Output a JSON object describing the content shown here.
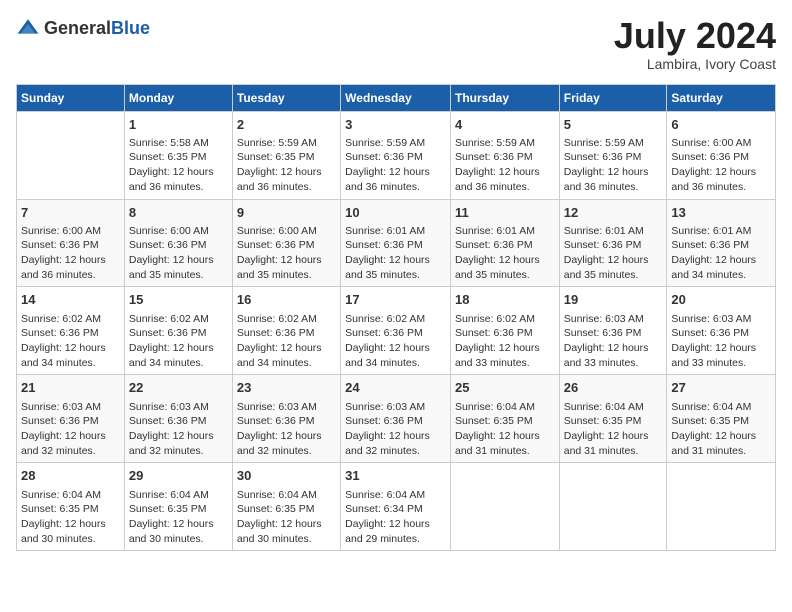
{
  "header": {
    "logo_general": "General",
    "logo_blue": "Blue",
    "main_title": "July 2024",
    "subtitle": "Lambira, Ivory Coast"
  },
  "days": [
    "Sunday",
    "Monday",
    "Tuesday",
    "Wednesday",
    "Thursday",
    "Friday",
    "Saturday"
  ],
  "weeks": [
    [
      {
        "date": "",
        "info": ""
      },
      {
        "date": "1",
        "info": "Sunrise: 5:58 AM\nSunset: 6:35 PM\nDaylight: 12 hours and 36 minutes."
      },
      {
        "date": "2",
        "info": "Sunrise: 5:59 AM\nSunset: 6:35 PM\nDaylight: 12 hours and 36 minutes."
      },
      {
        "date": "3",
        "info": "Sunrise: 5:59 AM\nSunset: 6:36 PM\nDaylight: 12 hours and 36 minutes."
      },
      {
        "date": "4",
        "info": "Sunrise: 5:59 AM\nSunset: 6:36 PM\nDaylight: 12 hours and 36 minutes."
      },
      {
        "date": "5",
        "info": "Sunrise: 5:59 AM\nSunset: 6:36 PM\nDaylight: 12 hours and 36 minutes."
      },
      {
        "date": "6",
        "info": "Sunrise: 6:00 AM\nSunset: 6:36 PM\nDaylight: 12 hours and 36 minutes."
      }
    ],
    [
      {
        "date": "7",
        "info": "Sunrise: 6:00 AM\nSunset: 6:36 PM\nDaylight: 12 hours and 36 minutes."
      },
      {
        "date": "8",
        "info": "Sunrise: 6:00 AM\nSunset: 6:36 PM\nDaylight: 12 hours and 35 minutes."
      },
      {
        "date": "9",
        "info": "Sunrise: 6:00 AM\nSunset: 6:36 PM\nDaylight: 12 hours and 35 minutes."
      },
      {
        "date": "10",
        "info": "Sunrise: 6:01 AM\nSunset: 6:36 PM\nDaylight: 12 hours and 35 minutes."
      },
      {
        "date": "11",
        "info": "Sunrise: 6:01 AM\nSunset: 6:36 PM\nDaylight: 12 hours and 35 minutes."
      },
      {
        "date": "12",
        "info": "Sunrise: 6:01 AM\nSunset: 6:36 PM\nDaylight: 12 hours and 35 minutes."
      },
      {
        "date": "13",
        "info": "Sunrise: 6:01 AM\nSunset: 6:36 PM\nDaylight: 12 hours and 34 minutes."
      }
    ],
    [
      {
        "date": "14",
        "info": "Sunrise: 6:02 AM\nSunset: 6:36 PM\nDaylight: 12 hours and 34 minutes."
      },
      {
        "date": "15",
        "info": "Sunrise: 6:02 AM\nSunset: 6:36 PM\nDaylight: 12 hours and 34 minutes."
      },
      {
        "date": "16",
        "info": "Sunrise: 6:02 AM\nSunset: 6:36 PM\nDaylight: 12 hours and 34 minutes."
      },
      {
        "date": "17",
        "info": "Sunrise: 6:02 AM\nSunset: 6:36 PM\nDaylight: 12 hours and 34 minutes."
      },
      {
        "date": "18",
        "info": "Sunrise: 6:02 AM\nSunset: 6:36 PM\nDaylight: 12 hours and 33 minutes."
      },
      {
        "date": "19",
        "info": "Sunrise: 6:03 AM\nSunset: 6:36 PM\nDaylight: 12 hours and 33 minutes."
      },
      {
        "date": "20",
        "info": "Sunrise: 6:03 AM\nSunset: 6:36 PM\nDaylight: 12 hours and 33 minutes."
      }
    ],
    [
      {
        "date": "21",
        "info": "Sunrise: 6:03 AM\nSunset: 6:36 PM\nDaylight: 12 hours and 32 minutes."
      },
      {
        "date": "22",
        "info": "Sunrise: 6:03 AM\nSunset: 6:36 PM\nDaylight: 12 hours and 32 minutes."
      },
      {
        "date": "23",
        "info": "Sunrise: 6:03 AM\nSunset: 6:36 PM\nDaylight: 12 hours and 32 minutes."
      },
      {
        "date": "24",
        "info": "Sunrise: 6:03 AM\nSunset: 6:36 PM\nDaylight: 12 hours and 32 minutes."
      },
      {
        "date": "25",
        "info": "Sunrise: 6:04 AM\nSunset: 6:35 PM\nDaylight: 12 hours and 31 minutes."
      },
      {
        "date": "26",
        "info": "Sunrise: 6:04 AM\nSunset: 6:35 PM\nDaylight: 12 hours and 31 minutes."
      },
      {
        "date": "27",
        "info": "Sunrise: 6:04 AM\nSunset: 6:35 PM\nDaylight: 12 hours and 31 minutes."
      }
    ],
    [
      {
        "date": "28",
        "info": "Sunrise: 6:04 AM\nSunset: 6:35 PM\nDaylight: 12 hours and 30 minutes."
      },
      {
        "date": "29",
        "info": "Sunrise: 6:04 AM\nSunset: 6:35 PM\nDaylight: 12 hours and 30 minutes."
      },
      {
        "date": "30",
        "info": "Sunrise: 6:04 AM\nSunset: 6:35 PM\nDaylight: 12 hours and 30 minutes."
      },
      {
        "date": "31",
        "info": "Sunrise: 6:04 AM\nSunset: 6:34 PM\nDaylight: 12 hours and 29 minutes."
      },
      {
        "date": "",
        "info": ""
      },
      {
        "date": "",
        "info": ""
      },
      {
        "date": "",
        "info": ""
      }
    ]
  ]
}
